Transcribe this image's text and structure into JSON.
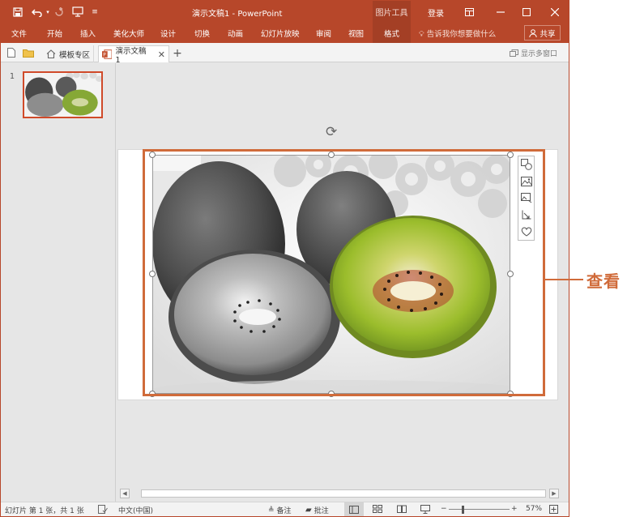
{
  "window": {
    "title": "演示文稿1 - PowerPoint",
    "context_tab": "图片工具",
    "login": "登录"
  },
  "ribbon": {
    "tabs": [
      "文件",
      "开始",
      "插入",
      "美化大师",
      "设计",
      "切换",
      "动画",
      "幻灯片放映",
      "审阅",
      "视图",
      "格式"
    ],
    "active_tab": "格式",
    "tell_me": "告诉我你想要做什么",
    "share": "共享"
  },
  "tabstrip": {
    "template_tab": "模板专区",
    "doc_tab": "演示文稿1",
    "multi_window": "显示多窗口"
  },
  "thumbnails": {
    "slide_number": "1"
  },
  "statusbar": {
    "slide_info": "幻灯片 第 1 张，共 1 张",
    "language": "中文(中国)",
    "notes": "备注",
    "comments": "批注",
    "zoom": "57%"
  },
  "annotation": {
    "label": "查看"
  },
  "colors": {
    "accent": "#b7472a",
    "context": "#a43f25",
    "highlight": "#d06b3a"
  }
}
